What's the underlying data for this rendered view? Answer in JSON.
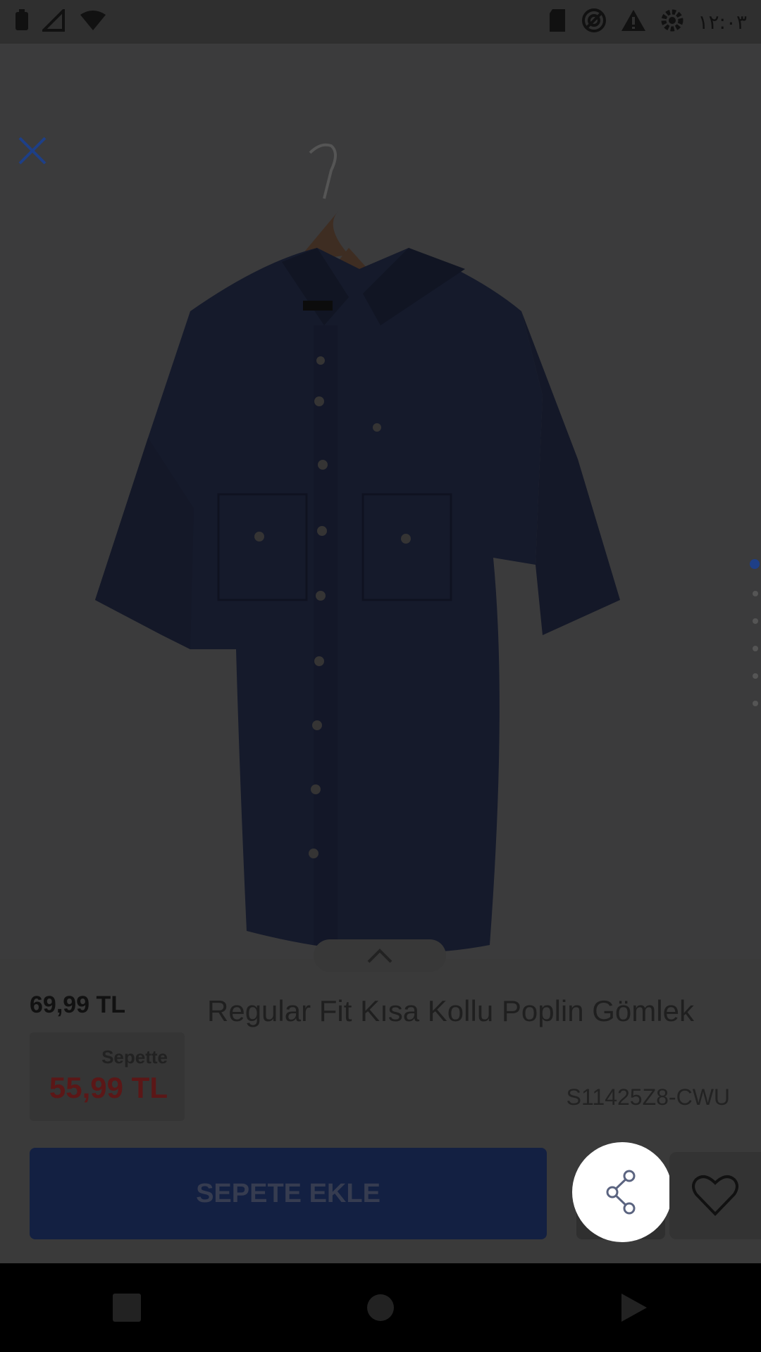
{
  "status_bar": {
    "time": "١٢:٠٣",
    "left_icons": [
      "battery-icon",
      "signal-icon",
      "wifi-icon"
    ],
    "right_icons": [
      "sd-card-icon",
      "sync-icon",
      "warning-icon",
      "settings-icon"
    ]
  },
  "gallery": {
    "image_alt": "Regular Fit Kısa Kollu Poplin Gömlek",
    "pagination_count": 6,
    "active_index": 0
  },
  "product": {
    "price": "69,99 TL",
    "cart_label": "Sepette",
    "cart_price": "55,99 TL",
    "title": "Regular Fit Kısa Kollu Poplin Gömlek",
    "sku": "S11425Z8-CWU"
  },
  "actions": {
    "add_to_cart": "SEPETE EKLE"
  },
  "colors": {
    "accent": "#1e3f87",
    "sale_price": "#b3322f",
    "overlay": "#3b3b3c"
  }
}
